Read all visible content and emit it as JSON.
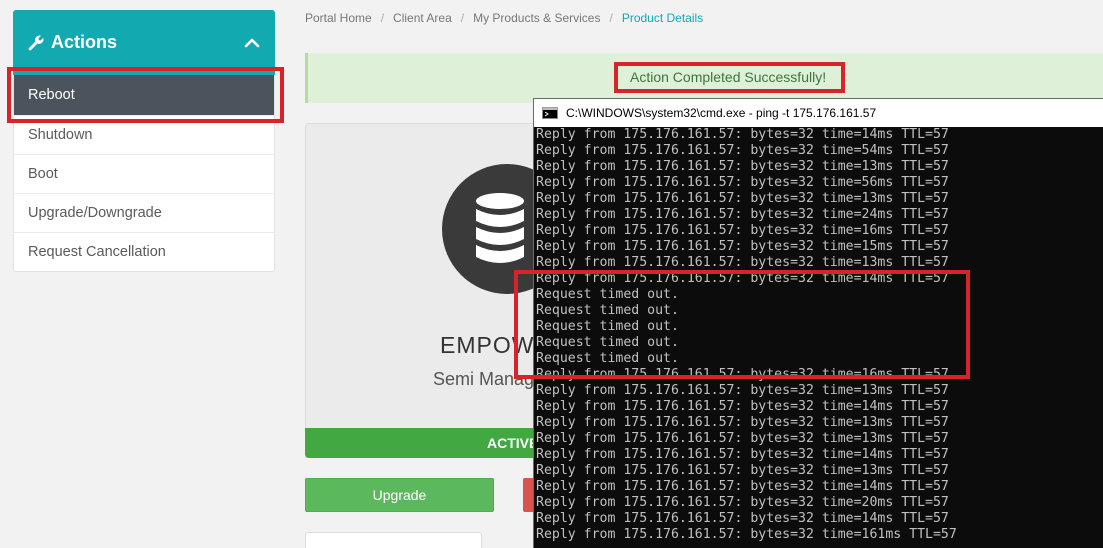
{
  "sidebar": {
    "header": "Actions",
    "items": [
      {
        "label": "Reboot",
        "active": true
      },
      {
        "label": "Shutdown"
      },
      {
        "label": "Boot"
      },
      {
        "label": "Upgrade/Downgrade"
      },
      {
        "label": "Request Cancellation"
      }
    ]
  },
  "breadcrumb": [
    "Portal Home",
    "Client Area",
    "My Products & Services",
    "Product Details"
  ],
  "alert": {
    "message": "Action Completed Successfully!"
  },
  "product": {
    "name": "EMPOW",
    "subtitle": "Semi Manag",
    "status": "ACTIVE"
  },
  "buttons": {
    "upgrade": "Upgrade"
  },
  "cmd": {
    "title": "C:\\WINDOWS\\system32\\cmd.exe - ping  -t 175.176.161.57",
    "lines": [
      "Reply from 175.176.161.57: bytes=32 time=14ms TTL=57",
      "Reply from 175.176.161.57: bytes=32 time=54ms TTL=57",
      "Reply from 175.176.161.57: bytes=32 time=13ms TTL=57",
      "Reply from 175.176.161.57: bytes=32 time=56ms TTL=57",
      "Reply from 175.176.161.57: bytes=32 time=13ms TTL=57",
      "Reply from 175.176.161.57: bytes=32 time=24ms TTL=57",
      "Reply from 175.176.161.57: bytes=32 time=16ms TTL=57",
      "Reply from 175.176.161.57: bytes=32 time=15ms TTL=57",
      "Reply from 175.176.161.57: bytes=32 time=13ms TTL=57",
      "Reply from 175.176.161.57: bytes=32 time=14ms TTL=57",
      "Request timed out.",
      "Request timed out.",
      "Request timed out.",
      "Request timed out.",
      "Request timed out.",
      "Reply from 175.176.161.57: bytes=32 time=16ms TTL=57",
      "Reply from 175.176.161.57: bytes=32 time=13ms TTL=57",
      "Reply from 175.176.161.57: bytes=32 time=14ms TTL=57",
      "Reply from 175.176.161.57: bytes=32 time=13ms TTL=57",
      "Reply from 175.176.161.57: bytes=32 time=13ms TTL=57",
      "Reply from 175.176.161.57: bytes=32 time=14ms TTL=57",
      "Reply from 175.176.161.57: bytes=32 time=13ms TTL=57",
      "Reply from 175.176.161.57: bytes=32 time=14ms TTL=57",
      "Reply from 175.176.161.57: bytes=32 time=20ms TTL=57",
      "Reply from 175.176.161.57: bytes=32 time=14ms TTL=57",
      "Reply from 175.176.161.57: bytes=32 time=161ms TTL=57"
    ]
  },
  "icons": {
    "actions": "wrench-icon",
    "collapse": "chevron-up-icon",
    "product": "database-icon",
    "cmd": "cmd-window-icon"
  },
  "colors": {
    "accent": "#12a9b1",
    "sidebar_active": "#4b545c",
    "alert_bg": "#dff0d8",
    "alert_text": "#3c763d",
    "status_active": "#42a842",
    "upgrade_btn": "#5cb85c",
    "cancel_btn": "#d9534f",
    "highlight": "#d8232a"
  }
}
